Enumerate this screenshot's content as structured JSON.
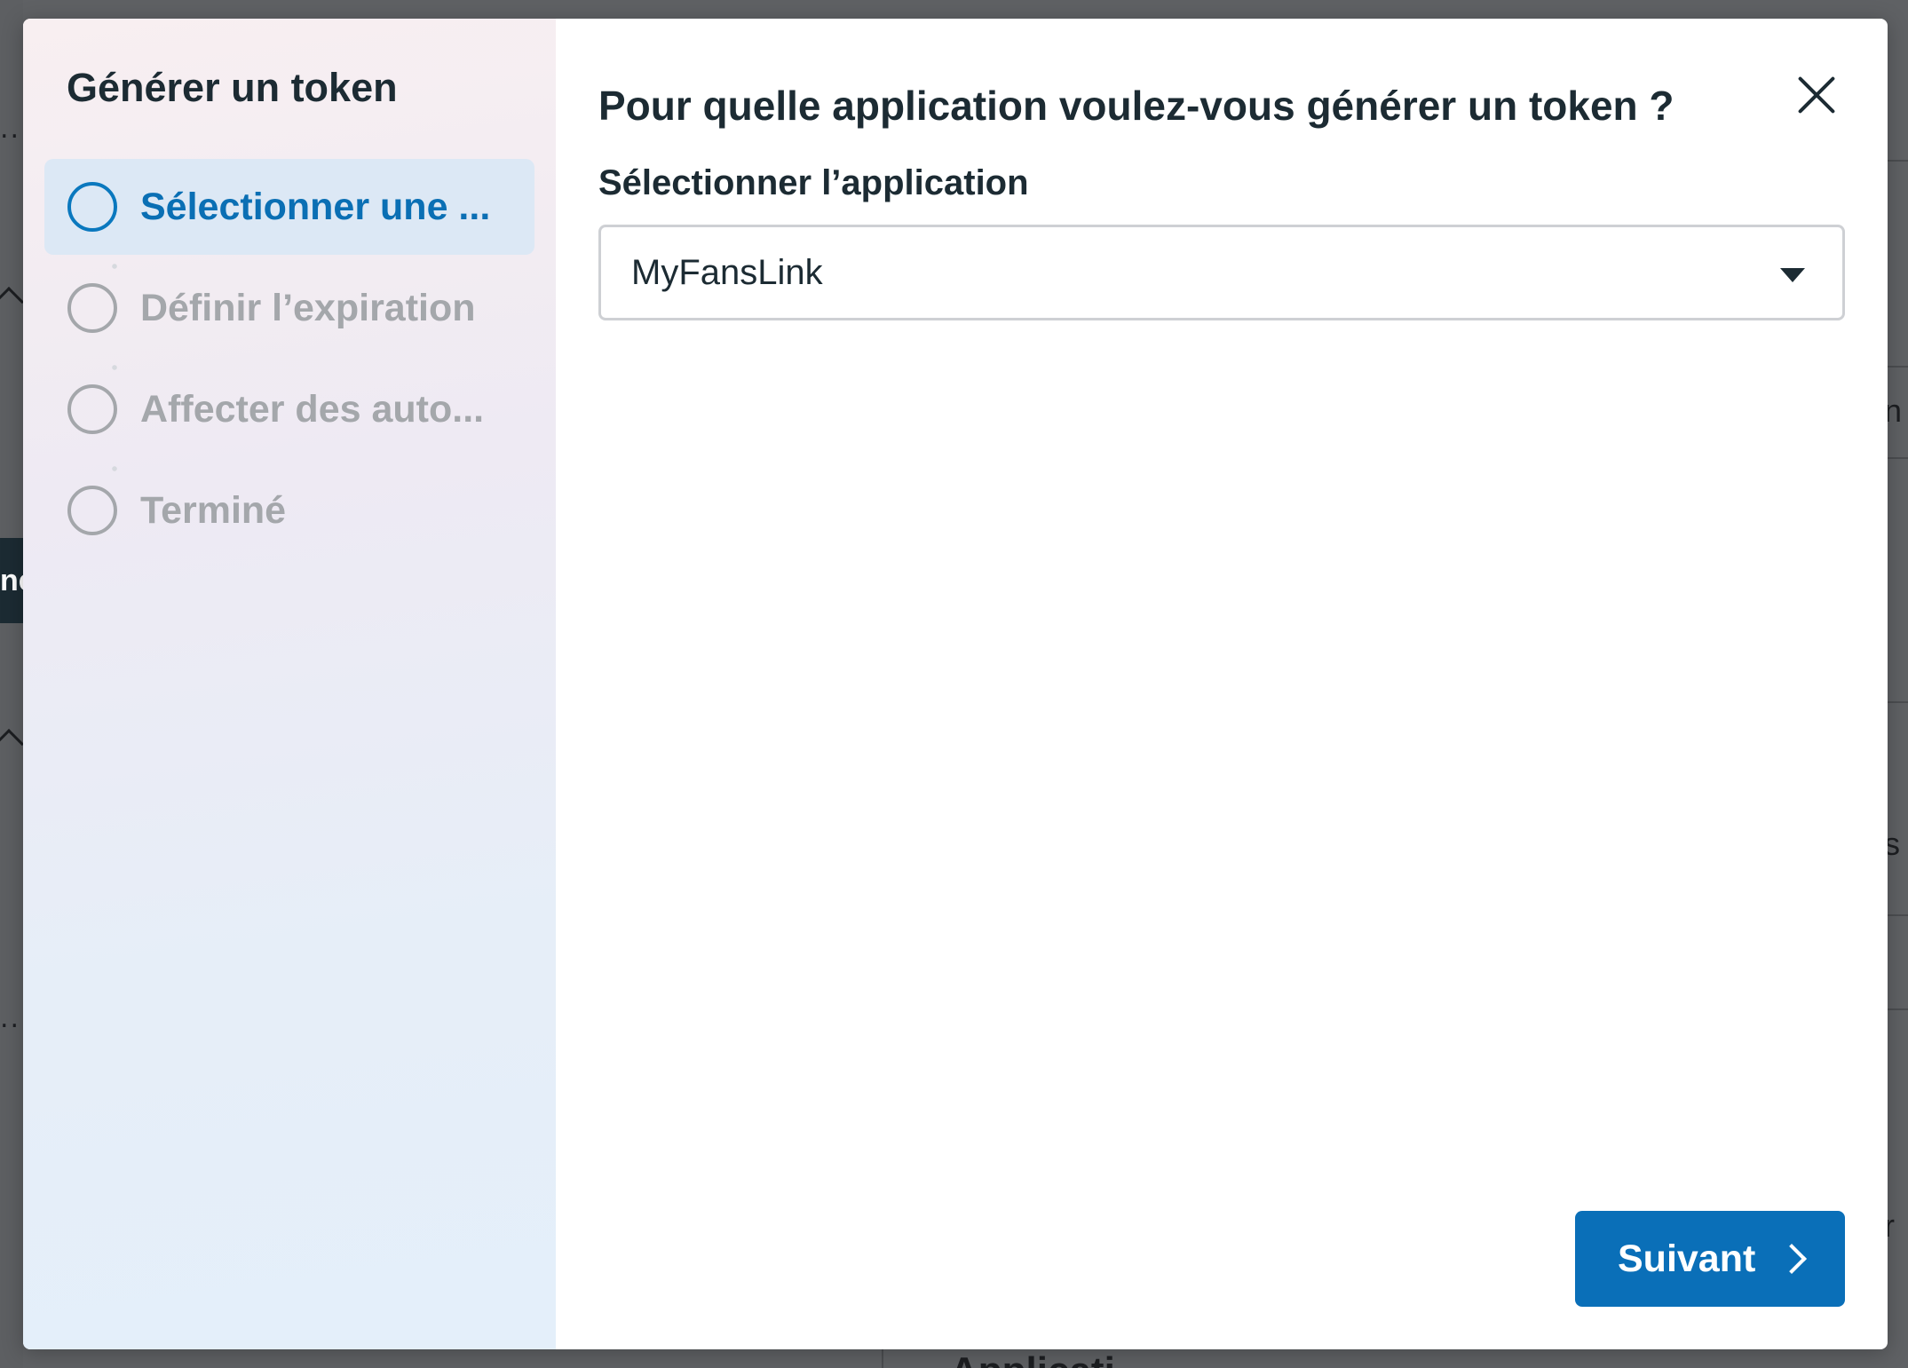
{
  "background": {
    "left_ellipsis": "...",
    "left_dark_text": "ne",
    "right_chars": [
      "n",
      "s",
      "r"
    ],
    "bottom_text": "Applicati"
  },
  "modal": {
    "sidebar": {
      "title": "Générer un token",
      "steps": [
        {
          "label": "Sélectionner une ...",
          "state": "active"
        },
        {
          "label": "Définir l’expiration",
          "state": "pending"
        },
        {
          "label": "Affecter des auto...",
          "state": "pending"
        },
        {
          "label": "Terminé",
          "state": "pending"
        }
      ]
    },
    "content": {
      "title": "Pour quelle application voulez-vous générer un token ?",
      "field_label": "Sélectionner l’application",
      "select_value": "MyFansLink",
      "next_label": "Suivant"
    },
    "icons": {
      "close": "close-icon",
      "dropdown": "caret-down-icon",
      "next": "chevron-right-icon",
      "step": "circle-outline-icon"
    },
    "colors": {
      "accent": "#0a6fb8",
      "active_step_bg": "#dce8f5",
      "inactive_text": "#a4a7ab",
      "text": "#1c2b33"
    }
  }
}
